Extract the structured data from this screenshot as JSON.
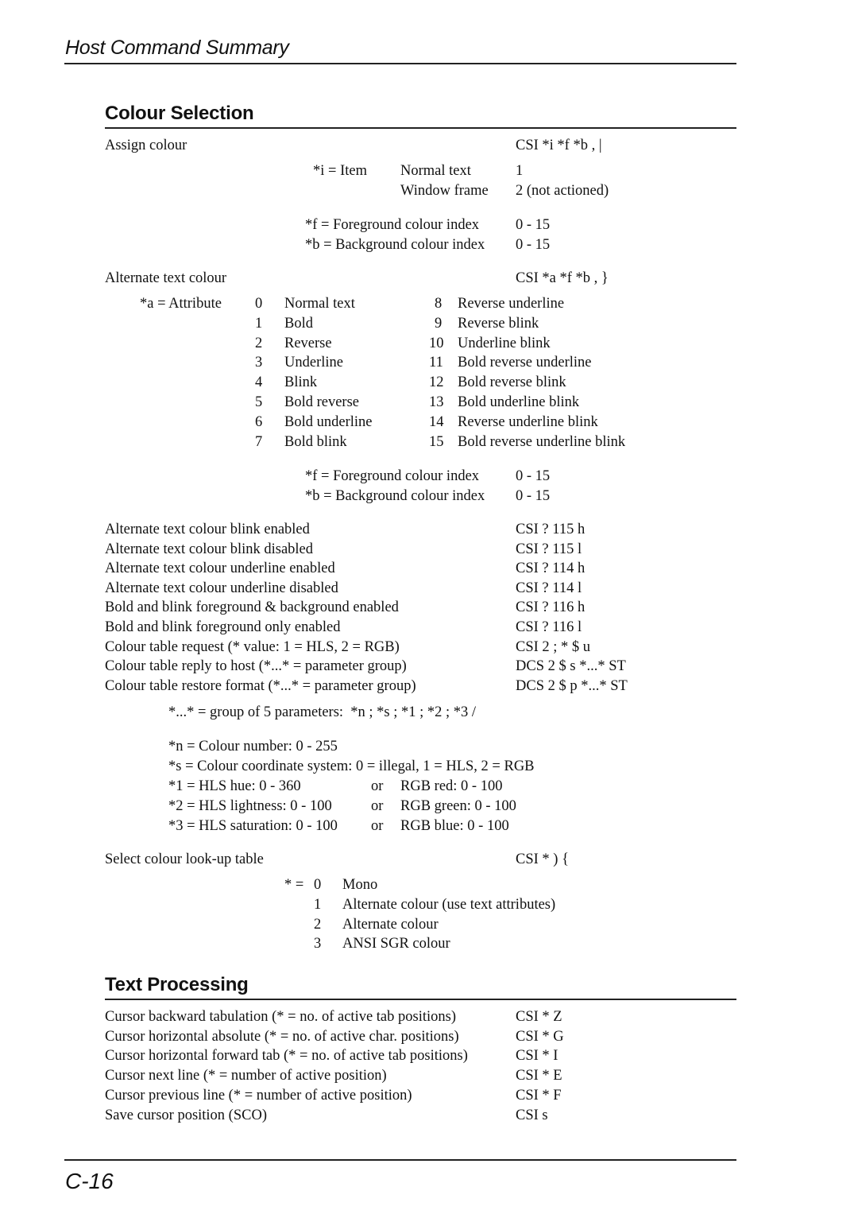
{
  "header": {
    "title": "Host Command Summary"
  },
  "footer": {
    "page_number": "C-16"
  },
  "colour_selection": {
    "heading": "Colour Selection",
    "assign_colour": {
      "label": "Assign colour",
      "command": "CSI *i *f *b , |",
      "item_param": "*i = Item",
      "items": [
        {
          "name": "Normal text",
          "value": "1"
        },
        {
          "name": "Window frame",
          "value": "2 (not actioned)"
        }
      ],
      "fg": {
        "label": "*f = Foreground colour index",
        "range": "0 - 15"
      },
      "bg": {
        "label": "*b = Background colour index",
        "range": "0 - 15"
      }
    },
    "alternate_text_colour": {
      "label": "Alternate text colour",
      "command": "CSI *a *f *b , }",
      "attr_param": "*a = Attribute",
      "attributes": [
        {
          "n": "0",
          "name": "Normal text"
        },
        {
          "n": "1",
          "name": "Bold"
        },
        {
          "n": "2",
          "name": "Reverse"
        },
        {
          "n": "3",
          "name": "Underline"
        },
        {
          "n": "4",
          "name": "Blink"
        },
        {
          "n": "5",
          "name": "Bold reverse"
        },
        {
          "n": "6",
          "name": "Bold underline"
        },
        {
          "n": "7",
          "name": "Bold blink"
        },
        {
          "n": "8",
          "name": "Reverse underline"
        },
        {
          "n": "9",
          "name": "Reverse blink"
        },
        {
          "n": "10",
          "name": "Underline blink"
        },
        {
          "n": "11",
          "name": "Bold reverse underline"
        },
        {
          "n": "12",
          "name": "Bold reverse blink"
        },
        {
          "n": "13",
          "name": "Bold underline blink"
        },
        {
          "n": "14",
          "name": "Reverse underline blink"
        },
        {
          "n": "15",
          "name": "Bold reverse underline blink"
        }
      ],
      "fg": {
        "label": "*f = Foreground colour index",
        "range": "0 - 15"
      },
      "bg": {
        "label": "*b = Background colour index",
        "range": "0 - 15"
      }
    },
    "commands": [
      {
        "desc": "Alternate text colour blink enabled",
        "cmd": "CSI ? 115 h"
      },
      {
        "desc": "Alternate text colour blink disabled",
        "cmd": "CSI ? 115 l"
      },
      {
        "desc": "Alternate text colour underline enabled",
        "cmd": "CSI ? 114 h"
      },
      {
        "desc": "Alternate text colour underline disabled",
        "cmd": "CSI ? 114 l"
      },
      {
        "desc": "Bold and blink foreground & background enabled",
        "cmd": "CSI ? 116 h"
      },
      {
        "desc": "Bold and blink foreground only enabled",
        "cmd": "CSI ? 116 l"
      },
      {
        "desc": "Colour table request (* value: 1 = HLS, 2 = RGB)",
        "cmd": "CSI 2 ; * $ u"
      },
      {
        "desc": "Colour table reply to host (*...* = parameter group)",
        "cmd": "DCS 2 $ s *...* ST"
      },
      {
        "desc": "Colour table restore format (*...* = parameter group)",
        "cmd": "DCS 2 $ p *...* ST"
      }
    ],
    "param_group": {
      "intro": "*...* = group of 5 parameters:  *n ; *s ; *1 ; *2 ; *3 /",
      "n": "*n = Colour number: 0 - 255",
      "s": "*s = Colour coordinate system: 0 = illegal, 1 = HLS, 2 = RGB",
      "rows": [
        {
          "hls": "*1 = HLS hue: 0 - 360",
          "or": "or",
          "rgb": "RGB red: 0 - 100"
        },
        {
          "hls": "*2 = HLS lightness: 0 - 100",
          "or": "or",
          "rgb": "RGB green: 0 - 100"
        },
        {
          "hls": "*3 = HLS saturation: 0 - 100",
          "or": "or",
          "rgb": "RGB blue: 0 - 100"
        }
      ]
    },
    "lookup_table": {
      "label": "Select colour look-up table",
      "command": "CSI * ) {",
      "prefix": "* =",
      "options": [
        {
          "n": "0",
          "name": "Mono"
        },
        {
          "n": "1",
          "name": "Alternate colour (use text attributes)"
        },
        {
          "n": "2",
          "name": "Alternate colour"
        },
        {
          "n": "3",
          "name": "ANSI SGR colour"
        }
      ]
    }
  },
  "text_processing": {
    "heading": "Text Processing",
    "commands": [
      {
        "desc": "Cursor backward tabulation (* = no. of active tab positions)",
        "cmd": "CSI * Z"
      },
      {
        "desc": "Cursor horizontal absolute (* = no. of active char. positions)",
        "cmd": "CSI * G"
      },
      {
        "desc": "Cursor horizontal forward tab (* = no. of active tab positions)",
        "cmd": "CSI * I"
      },
      {
        "desc": "Cursor next line (* = number of active position)",
        "cmd": "CSI * E"
      },
      {
        "desc": "Cursor previous line (* = number of active position)",
        "cmd": "CSI * F"
      },
      {
        "desc": "Save cursor position (SCO)",
        "cmd": "CSI s"
      }
    ]
  }
}
